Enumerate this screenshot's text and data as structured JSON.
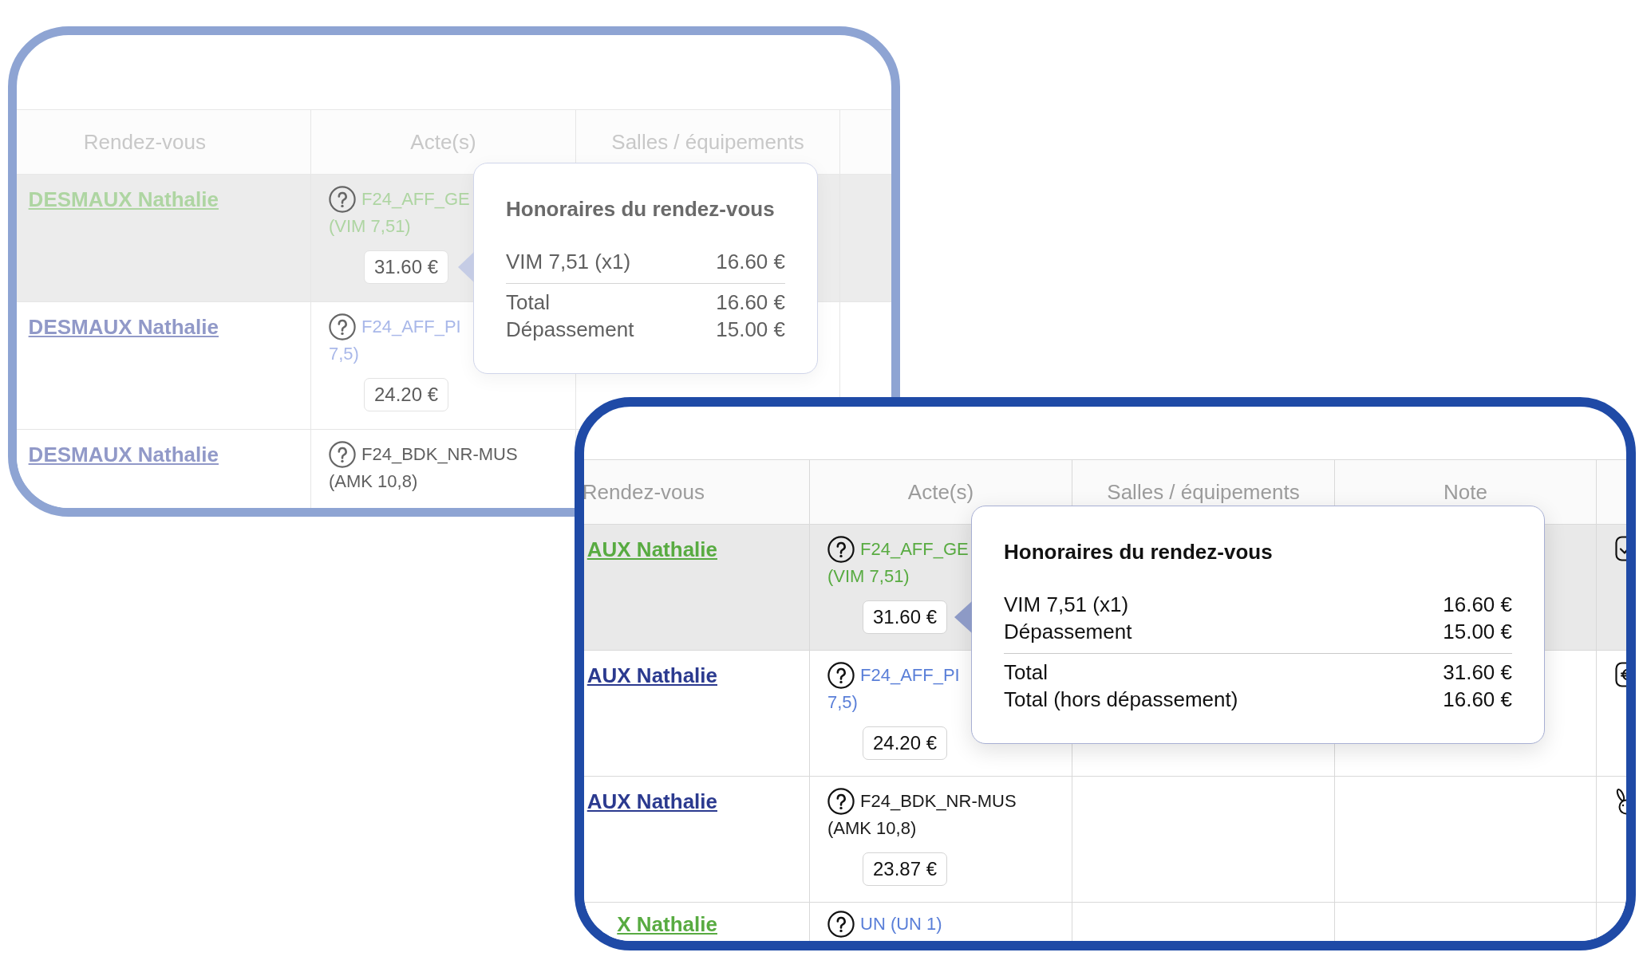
{
  "panels": [
    {
      "dimmed": true,
      "columns": [
        "Rendez-vous",
        "Acte(s)",
        "Salles / équipements"
      ],
      "rows": [
        {
          "highlighted": true,
          "patient": {
            "text": "DESMAUX Nathalie",
            "color": "#aed5a2"
          },
          "act": {
            "code": "F24_AFF_GE",
            "detail": "(VIM 7,51)",
            "color": "#aed5a2"
          },
          "fee": "31.60 €"
        },
        {
          "highlighted": false,
          "patient": {
            "text": "DESMAUX Nathalie",
            "color": "#9199c8"
          },
          "act": {
            "code": "F24_AFF_PI",
            "detail": "7,5)",
            "color": "#a9b8e9"
          },
          "fee": "24.20 €"
        },
        {
          "highlighted": false,
          "patient": {
            "text": "DESMAUX Nathalie",
            "color": "#9199c8"
          },
          "act": {
            "code": "F24_BDK_NR-MUS",
            "detail": "(AMK 10,8)",
            "color": "#5f5f5f"
          }
        }
      ],
      "tooltip": {
        "title": "Honoraires du rendez-vous",
        "lines": [
          {
            "label": "VIM 7,51 (x1)",
            "amount": "16.60 €"
          }
        ],
        "totals": [
          {
            "label": "Total",
            "amount": "16.60 €"
          },
          {
            "label": "Dépassement",
            "amount": "15.00 €"
          }
        ]
      }
    },
    {
      "dimmed": false,
      "columns": [
        "Rendez-vous",
        "Acte(s)",
        "Salles / équipements",
        "Note"
      ],
      "rows": [
        {
          "highlighted": true,
          "patient": {
            "text": "AUX Nathalie",
            "color": "#58ab41"
          },
          "act": {
            "code": "F24_AFF_GE",
            "detail": "(VIM 7,51)",
            "color": "#58ab41"
          },
          "fee": "31.60 €"
        },
        {
          "highlighted": false,
          "patient": {
            "text": "AUX Nathalie",
            "color": "#2b3a8f"
          },
          "act": {
            "code": "F24_AFF_PI",
            "detail": "7,5)",
            "color": "#5a7fd8"
          },
          "fee": "24.20 €"
        },
        {
          "highlighted": false,
          "patient": {
            "text": "AUX Nathalie",
            "color": "#2b3a8f"
          },
          "act": {
            "code": "F24_BDK_NR-MUS",
            "detail": "(AMK 10,8)",
            "color": "#1a1a1a"
          },
          "fee": "23.87 €"
        },
        {
          "highlighted": false,
          "patient": {
            "text": "X Nathalie",
            "color": "#58ab41"
          },
          "act": {
            "code": "UN (UN 1)",
            "color": "#5a7fd8"
          }
        }
      ],
      "tooltip": {
        "title": "Honoraires du rendez-vous",
        "lines": [
          {
            "label": "VIM 7,51 (x1)",
            "amount": "16.60 €"
          },
          {
            "label": "Dépassement",
            "amount": "15.00 €"
          }
        ],
        "totals": [
          {
            "label": "Total",
            "amount": "31.60 €"
          },
          {
            "label": "Total (hors dépassement)",
            "amount": "16.60 €"
          }
        ]
      }
    }
  ]
}
